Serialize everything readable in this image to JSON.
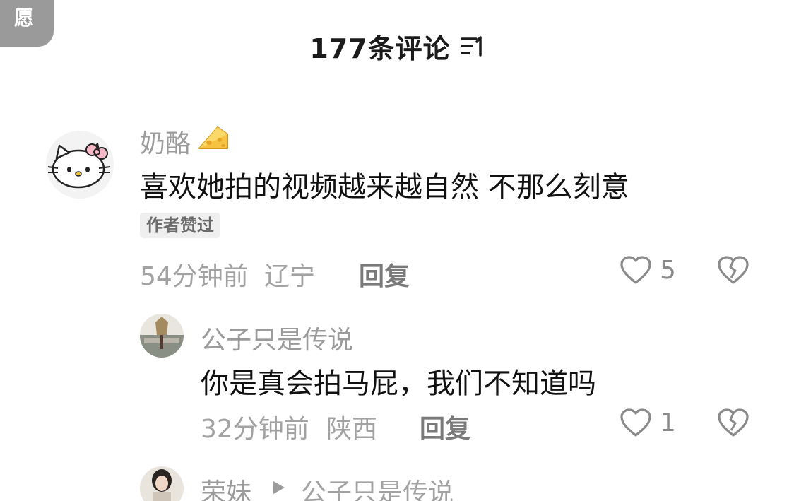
{
  "corner_badge": "愿",
  "header": {
    "title": "177条评论",
    "sort_icon": "sort-icon"
  },
  "comments": [
    {
      "username": "奶酪",
      "username_emoji": "cheese-icon",
      "text": "喜欢她拍的视频越来越自然 不那么刻意",
      "author_tag": "作者赞过",
      "time": "54分钟前",
      "location": "辽宁",
      "reply_label": "回复",
      "likes": "5"
    }
  ],
  "replies": [
    {
      "username": "公子只是传说",
      "text": "你是真会拍马屁，我们不知道吗",
      "time": "32分钟前",
      "location": "陕西",
      "reply_label": "回复",
      "likes": "1"
    },
    {
      "username": "荣妹",
      "reply_to": "公子只是传说"
    }
  ],
  "colors": {
    "text_primary": "#111111",
    "text_secondary": "#a2a2a2",
    "badge_bg": "#9a9a9a"
  }
}
